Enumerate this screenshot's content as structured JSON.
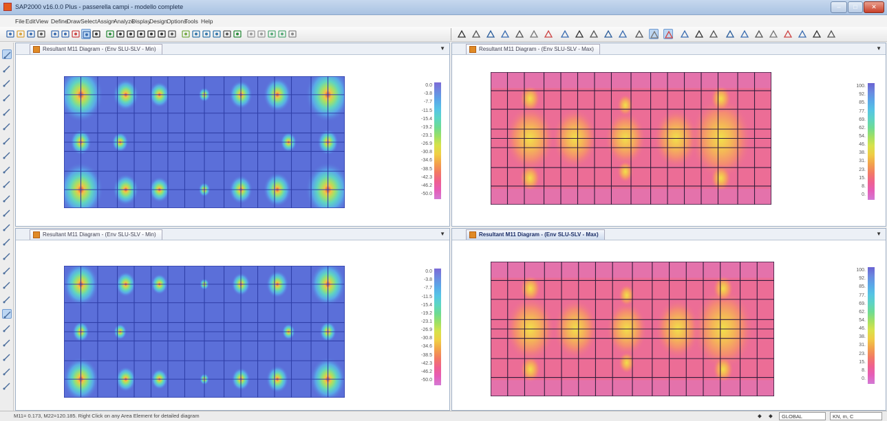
{
  "window": {
    "title": "SAP2000 v16.0.0 Plus - passerella campi - modello complete"
  },
  "menu": [
    "File",
    "Edit",
    "View",
    "Define",
    "Draw",
    "Select",
    "Assign",
    "Analyze",
    "Display",
    "Design",
    "Options",
    "Tools",
    "Help"
  ],
  "colors": {
    "accent": "#3a8ee6",
    "frame": "#9fb0c6"
  },
  "panels": [
    {
      "tab_label": "Resultant M11 Diagram - (Env SLU-SLV - Min)",
      "kind": "min",
      "active": false
    },
    {
      "tab_label": "Resultant M11 Diagram - (Env SLU-SLV - Max)",
      "kind": "max",
      "active": false
    },
    {
      "tab_label": "Resultant M11 Diagram - (Env SLU-SLV - Min)",
      "kind": "min",
      "active": false
    },
    {
      "tab_label": "Resultant M11 Diagram - (Env SLU-SLV - Max)",
      "kind": "max",
      "active": true
    }
  ],
  "legend_min": {
    "labels": [
      "0.0",
      "-3.8",
      "-7.7",
      "-11.5",
      "-15.4",
      "-19.2",
      "-23.1",
      "-26.9",
      "-30.8",
      "-34.6",
      "-38.5",
      "-42.3",
      "-46.2",
      "-50.0"
    ],
    "colors": [
      "#7b6ad6",
      "#6d8ae0",
      "#5aa8e8",
      "#57c4e6",
      "#5cd6c4",
      "#6ddb92",
      "#9ce064",
      "#d7e24a",
      "#f0cf45",
      "#f2a34a",
      "#f27a62",
      "#ef5f8e",
      "#e65cb7",
      "#d47ad4"
    ]
  },
  "legend_max": {
    "labels": [
      "100.",
      "92.",
      "85.",
      "77.",
      "69.",
      "62.",
      "54.",
      "46.",
      "38.",
      "31.",
      "23.",
      "15.",
      "8.",
      "0."
    ],
    "colors": [
      "#6a63d2",
      "#6b8ae0",
      "#5aa8e8",
      "#56c4e4",
      "#5ed3c4",
      "#6fdb93",
      "#a4e063",
      "#d8e24c",
      "#f0cc46",
      "#f2a24c",
      "#f27c64",
      "#ef618f",
      "#e55eb8",
      "#d27ad5"
    ]
  },
  "status": {
    "text": "M11= 0.173, M22=120.185. Right Click on any Area Element for detailed diagram",
    "coord_system": "GLOBAL",
    "units": "KN, m, C"
  }
}
